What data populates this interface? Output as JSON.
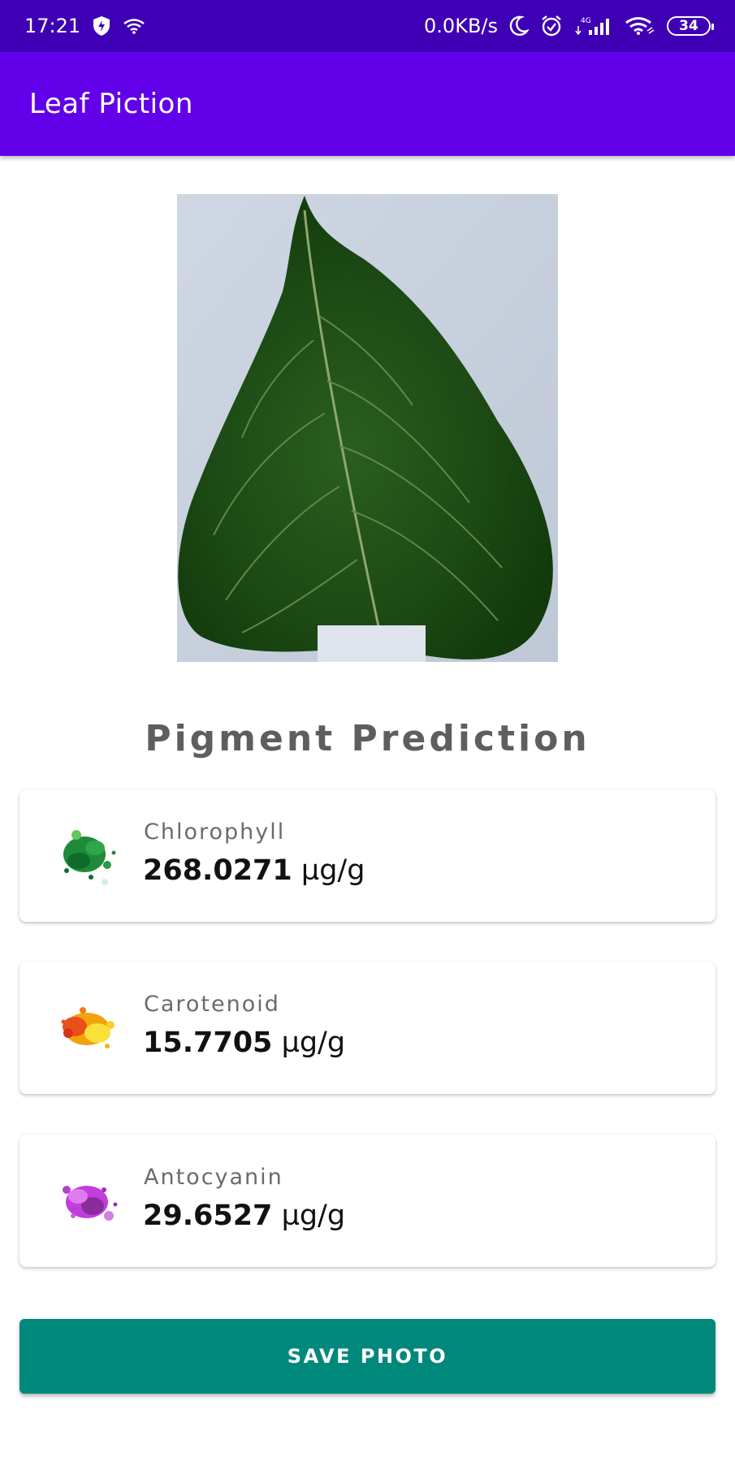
{
  "status_bar": {
    "time": "17:21",
    "network_speed": "0.0KB/s",
    "network_type": "4G",
    "battery_level": "34",
    "icons": [
      "shield-icon",
      "wifi-icon",
      "moon-icon",
      "alarm-icon",
      "signal-icon",
      "wifi-icon"
    ]
  },
  "app_bar": {
    "title": "Leaf Piction"
  },
  "photo": {
    "subject": "leaf"
  },
  "section": {
    "title": "Pigment Prediction"
  },
  "pigments": [
    {
      "label": "Chlorophyll",
      "value": "268.0271",
      "unit": "µg/g",
      "icon": "green-paint-splash-icon",
      "color": "#1f8a3a"
    },
    {
      "label": "Carotenoid",
      "value": "15.7705",
      "unit": "µg/g",
      "icon": "orange-paint-splash-icon",
      "color": "#f2a20c"
    },
    {
      "label": "Antocyanin",
      "value": "29.6527",
      "unit": "µg/g",
      "icon": "purple-paint-splash-icon",
      "color": "#c13ddc"
    }
  ],
  "actions": {
    "save_label": "SAVE PHOTO"
  },
  "colors": {
    "status_bar": "#3f00b5",
    "app_bar": "#6200ea",
    "button": "#00897b"
  }
}
